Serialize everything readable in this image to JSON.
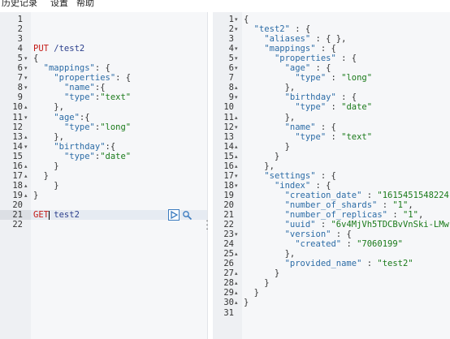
{
  "menu": [
    "历史记录",
    "设置",
    "帮助"
  ],
  "request_editor": {
    "lines": [
      {
        "n": "1",
        "fold": "",
        "tokens": []
      },
      {
        "n": "2",
        "fold": "",
        "tokens": []
      },
      {
        "n": "3",
        "fold": "",
        "tokens": []
      },
      {
        "n": "4",
        "fold": "",
        "tokens": [
          {
            "t": "PUT",
            "c": "method"
          },
          {
            "t": " /test2",
            "c": "path"
          }
        ]
      },
      {
        "n": "5",
        "fold": "▾",
        "tokens": [
          {
            "t": "{",
            "c": "punc"
          }
        ]
      },
      {
        "n": "6",
        "fold": "▾",
        "tokens": [
          {
            "t": "  ",
            "c": "plain"
          },
          {
            "t": "\"mappings\"",
            "c": "key"
          },
          {
            "t": ": {",
            "c": "punc"
          }
        ]
      },
      {
        "n": "7",
        "fold": "▾",
        "tokens": [
          {
            "t": "    ",
            "c": "plain"
          },
          {
            "t": "\"properties\"",
            "c": "key"
          },
          {
            "t": ": {",
            "c": "punc"
          }
        ]
      },
      {
        "n": "8",
        "fold": "▾",
        "tokens": [
          {
            "t": "      ",
            "c": "plain"
          },
          {
            "t": "\"name\"",
            "c": "key"
          },
          {
            "t": ":{",
            "c": "punc"
          }
        ]
      },
      {
        "n": "9",
        "fold": "",
        "tokens": [
          {
            "t": "      ",
            "c": "plain"
          },
          {
            "t": "\"type\"",
            "c": "key"
          },
          {
            "t": ":",
            "c": "punc"
          },
          {
            "t": "\"text\"",
            "c": "str"
          }
        ]
      },
      {
        "n": "10",
        "fold": "▴",
        "tokens": [
          {
            "t": "    },",
            "c": "punc"
          }
        ]
      },
      {
        "n": "11",
        "fold": "▾",
        "tokens": [
          {
            "t": "    ",
            "c": "plain"
          },
          {
            "t": "\"age\"",
            "c": "key"
          },
          {
            "t": ":{",
            "c": "punc"
          }
        ]
      },
      {
        "n": "12",
        "fold": "",
        "tokens": [
          {
            "t": "      ",
            "c": "plain"
          },
          {
            "t": "\"type\"",
            "c": "key"
          },
          {
            "t": ":",
            "c": "punc"
          },
          {
            "t": "\"long\"",
            "c": "str"
          }
        ]
      },
      {
        "n": "13",
        "fold": "▴",
        "tokens": [
          {
            "t": "    },",
            "c": "punc"
          }
        ]
      },
      {
        "n": "14",
        "fold": "▾",
        "tokens": [
          {
            "t": "    ",
            "c": "plain"
          },
          {
            "t": "\"birthday\"",
            "c": "key"
          },
          {
            "t": ":{",
            "c": "punc"
          }
        ]
      },
      {
        "n": "15",
        "fold": "",
        "tokens": [
          {
            "t": "      ",
            "c": "plain"
          },
          {
            "t": "\"type\"",
            "c": "key"
          },
          {
            "t": ":",
            "c": "punc"
          },
          {
            "t": "\"date\"",
            "c": "str"
          }
        ]
      },
      {
        "n": "16",
        "fold": "▴",
        "tokens": [
          {
            "t": "    }",
            "c": "punc"
          }
        ]
      },
      {
        "n": "17",
        "fold": "▴",
        "tokens": [
          {
            "t": "  }",
            "c": "punc"
          }
        ]
      },
      {
        "n": "18",
        "fold": "▴",
        "tokens": [
          {
            "t": "    }",
            "c": "punc"
          }
        ]
      },
      {
        "n": "19",
        "fold": "▴",
        "tokens": [
          {
            "t": "}",
            "c": "punc"
          }
        ]
      },
      {
        "n": "20",
        "fold": "",
        "tokens": []
      },
      {
        "n": "21",
        "fold": "",
        "tokens": [
          {
            "t": "GET",
            "c": "method"
          },
          {
            "t": " test2",
            "c": "path"
          }
        ]
      },
      {
        "n": "22",
        "fold": "",
        "tokens": []
      }
    ]
  },
  "response_viewer": {
    "lines": [
      {
        "n": "1",
        "fold": "▾",
        "tokens": [
          {
            "t": "{",
            "c": "punc"
          }
        ]
      },
      {
        "n": "2",
        "fold": "▾",
        "tokens": [
          {
            "t": "  ",
            "c": "plain"
          },
          {
            "t": "\"test2\"",
            "c": "key"
          },
          {
            "t": " : {",
            "c": "punc"
          }
        ]
      },
      {
        "n": "3",
        "fold": "",
        "tokens": [
          {
            "t": "    ",
            "c": "plain"
          },
          {
            "t": "\"aliases\"",
            "c": "key"
          },
          {
            "t": " : { },",
            "c": "punc"
          }
        ]
      },
      {
        "n": "4",
        "fold": "▾",
        "tokens": [
          {
            "t": "    ",
            "c": "plain"
          },
          {
            "t": "\"mappings\"",
            "c": "key"
          },
          {
            "t": " : {",
            "c": "punc"
          }
        ]
      },
      {
        "n": "5",
        "fold": "▾",
        "tokens": [
          {
            "t": "      ",
            "c": "plain"
          },
          {
            "t": "\"properties\"",
            "c": "key"
          },
          {
            "t": " : {",
            "c": "punc"
          }
        ]
      },
      {
        "n": "6",
        "fold": "▾",
        "tokens": [
          {
            "t": "        ",
            "c": "plain"
          },
          {
            "t": "\"age\"",
            "c": "key"
          },
          {
            "t": " : {",
            "c": "punc"
          }
        ]
      },
      {
        "n": "7",
        "fold": "",
        "tokens": [
          {
            "t": "          ",
            "c": "plain"
          },
          {
            "t": "\"type\"",
            "c": "key"
          },
          {
            "t": " : ",
            "c": "punc"
          },
          {
            "t": "\"long\"",
            "c": "str"
          }
        ]
      },
      {
        "n": "8",
        "fold": "▴",
        "tokens": [
          {
            "t": "        },",
            "c": "punc"
          }
        ]
      },
      {
        "n": "9",
        "fold": "▾",
        "tokens": [
          {
            "t": "        ",
            "c": "plain"
          },
          {
            "t": "\"birthday\"",
            "c": "key"
          },
          {
            "t": " : {",
            "c": "punc"
          }
        ]
      },
      {
        "n": "10",
        "fold": "",
        "tokens": [
          {
            "t": "          ",
            "c": "plain"
          },
          {
            "t": "\"type\"",
            "c": "key"
          },
          {
            "t": " : ",
            "c": "punc"
          },
          {
            "t": "\"date\"",
            "c": "str"
          }
        ]
      },
      {
        "n": "11",
        "fold": "▴",
        "tokens": [
          {
            "t": "        },",
            "c": "punc"
          }
        ]
      },
      {
        "n": "12",
        "fold": "▾",
        "tokens": [
          {
            "t": "        ",
            "c": "plain"
          },
          {
            "t": "\"name\"",
            "c": "key"
          },
          {
            "t": " : {",
            "c": "punc"
          }
        ]
      },
      {
        "n": "13",
        "fold": "",
        "tokens": [
          {
            "t": "          ",
            "c": "plain"
          },
          {
            "t": "\"type\"",
            "c": "key"
          },
          {
            "t": " : ",
            "c": "punc"
          },
          {
            "t": "\"text\"",
            "c": "str"
          }
        ]
      },
      {
        "n": "14",
        "fold": "▴",
        "tokens": [
          {
            "t": "        }",
            "c": "punc"
          }
        ]
      },
      {
        "n": "15",
        "fold": "▴",
        "tokens": [
          {
            "t": "      }",
            "c": "punc"
          }
        ]
      },
      {
        "n": "16",
        "fold": "▴",
        "tokens": [
          {
            "t": "    },",
            "c": "punc"
          }
        ]
      },
      {
        "n": "17",
        "fold": "▾",
        "tokens": [
          {
            "t": "    ",
            "c": "plain"
          },
          {
            "t": "\"settings\"",
            "c": "key"
          },
          {
            "t": " : {",
            "c": "punc"
          }
        ]
      },
      {
        "n": "18",
        "fold": "▾",
        "tokens": [
          {
            "t": "      ",
            "c": "plain"
          },
          {
            "t": "\"index\"",
            "c": "key"
          },
          {
            "t": " : {",
            "c": "punc"
          }
        ]
      },
      {
        "n": "19",
        "fold": "",
        "tokens": [
          {
            "t": "        ",
            "c": "plain"
          },
          {
            "t": "\"creation_date\"",
            "c": "key"
          },
          {
            "t": " : ",
            "c": "punc"
          },
          {
            "t": "\"1615451548224\"",
            "c": "str"
          },
          {
            "t": ",",
            "c": "punc"
          }
        ]
      },
      {
        "n": "20",
        "fold": "",
        "tokens": [
          {
            "t": "        ",
            "c": "plain"
          },
          {
            "t": "\"number_of_shards\"",
            "c": "key"
          },
          {
            "t": " : ",
            "c": "punc"
          },
          {
            "t": "\"1\"",
            "c": "str"
          },
          {
            "t": ",",
            "c": "punc"
          }
        ]
      },
      {
        "n": "21",
        "fold": "",
        "tokens": [
          {
            "t": "        ",
            "c": "plain"
          },
          {
            "t": "\"number_of_replicas\"",
            "c": "key"
          },
          {
            "t": " : ",
            "c": "punc"
          },
          {
            "t": "\"1\"",
            "c": "str"
          },
          {
            "t": ",",
            "c": "punc"
          }
        ]
      },
      {
        "n": "22",
        "fold": "",
        "tokens": [
          {
            "t": "        ",
            "c": "plain"
          },
          {
            "t": "\"uuid\"",
            "c": "key"
          },
          {
            "t": " : ",
            "c": "punc"
          },
          {
            "t": "\"6v4MjVh5TDCBvVnSki-LMw\"",
            "c": "str"
          },
          {
            "t": ",",
            "c": "punc"
          }
        ]
      },
      {
        "n": "23",
        "fold": "▾",
        "tokens": [
          {
            "t": "        ",
            "c": "plain"
          },
          {
            "t": "\"version\"",
            "c": "key"
          },
          {
            "t": " : {",
            "c": "punc"
          }
        ]
      },
      {
        "n": "24",
        "fold": "",
        "tokens": [
          {
            "t": "          ",
            "c": "plain"
          },
          {
            "t": "\"created\"",
            "c": "key"
          },
          {
            "t": " : ",
            "c": "punc"
          },
          {
            "t": "\"7060199\"",
            "c": "str"
          }
        ]
      },
      {
        "n": "25",
        "fold": "▴",
        "tokens": [
          {
            "t": "        },",
            "c": "punc"
          }
        ]
      },
      {
        "n": "26",
        "fold": "",
        "tokens": [
          {
            "t": "        ",
            "c": "plain"
          },
          {
            "t": "\"provided_name\"",
            "c": "key"
          },
          {
            "t": " : ",
            "c": "punc"
          },
          {
            "t": "\"test2\"",
            "c": "str"
          }
        ]
      },
      {
        "n": "27",
        "fold": "▴",
        "tokens": [
          {
            "t": "      }",
            "c": "punc"
          }
        ]
      },
      {
        "n": "28",
        "fold": "▴",
        "tokens": [
          {
            "t": "    }",
            "c": "punc"
          }
        ]
      },
      {
        "n": "29",
        "fold": "▴",
        "tokens": [
          {
            "t": "  }",
            "c": "punc"
          }
        ]
      },
      {
        "n": "30",
        "fold": "▴",
        "tokens": [
          {
            "t": "}",
            "c": "punc"
          }
        ]
      },
      {
        "n": "31",
        "fold": "",
        "tokens": []
      }
    ]
  },
  "icons": {
    "run": "play-icon",
    "settings": "wrench-icon",
    "splitter": "vertical-dots-icon"
  },
  "colors": {
    "method": "#c41a16",
    "key": "#2c6ca6",
    "string": "#1a7a1a",
    "run_button_border": "#3b7bbf"
  }
}
